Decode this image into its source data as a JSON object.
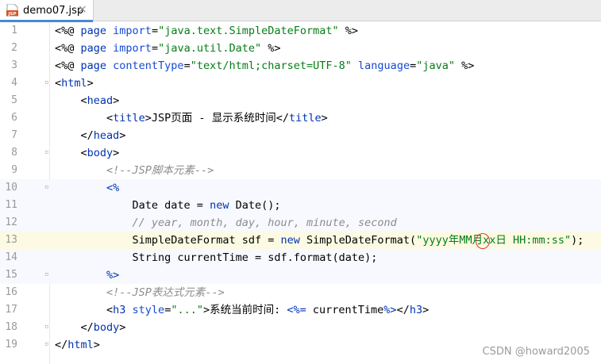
{
  "tab": {
    "icon": "jsp-file-icon",
    "icon_text": "JSP",
    "label": "demo07.jsp",
    "close": "×"
  },
  "editor": {
    "current_line": 13,
    "lines": [
      {
        "n": "1",
        "parts": [
          [
            "d",
            "<%@ "
          ],
          [
            "k",
            "page "
          ],
          [
            "a",
            "import"
          ],
          [
            "d",
            "="
          ],
          [
            "s",
            "\"java.text.SimpleDateFormat\""
          ],
          [
            "d",
            " %>"
          ]
        ]
      },
      {
        "n": "2",
        "parts": [
          [
            "d",
            "<%@ "
          ],
          [
            "k",
            "page "
          ],
          [
            "a",
            "import"
          ],
          [
            "d",
            "="
          ],
          [
            "s",
            "\"java.util.Date\""
          ],
          [
            "d",
            " %>"
          ]
        ]
      },
      {
        "n": "3",
        "parts": [
          [
            "d",
            "<%@ "
          ],
          [
            "k",
            "page "
          ],
          [
            "a",
            "contentType"
          ],
          [
            "d",
            "="
          ],
          [
            "s",
            "\"text/html;charset=UTF-8\""
          ],
          [
            "d",
            " "
          ],
          [
            "a",
            "language"
          ],
          [
            "d",
            "="
          ],
          [
            "s",
            "\"java\""
          ],
          [
            "d",
            " %>"
          ]
        ]
      },
      {
        "n": "4",
        "parts": [
          [
            "d",
            "<"
          ],
          [
            "t",
            "html"
          ],
          [
            "d",
            ">"
          ]
        ]
      },
      {
        "n": "5",
        "parts": [
          [
            "d",
            "    <"
          ],
          [
            "t",
            "head"
          ],
          [
            "d",
            ">"
          ]
        ]
      },
      {
        "n": "6",
        "parts": [
          [
            "d",
            "        <"
          ],
          [
            "t",
            "title"
          ],
          [
            "d",
            ">JSP页面 - 显示系统时间</"
          ],
          [
            "t",
            "title"
          ],
          [
            "d",
            ">"
          ]
        ]
      },
      {
        "n": "7",
        "parts": [
          [
            "d",
            "    </"
          ],
          [
            "t",
            "head"
          ],
          [
            "d",
            ">"
          ]
        ]
      },
      {
        "n": "8",
        "parts": [
          [
            "d",
            "    <"
          ],
          [
            "t",
            "body"
          ],
          [
            "d",
            ">"
          ]
        ]
      },
      {
        "n": "9",
        "parts": [
          [
            "c",
            "        <!--JSP脚本元素-->"
          ]
        ]
      },
      {
        "n": "10",
        "parts": [
          [
            "d",
            "        "
          ],
          [
            "t",
            "<%"
          ]
        ]
      },
      {
        "n": "11",
        "parts": [
          [
            "d",
            "            Date date = "
          ],
          [
            "k",
            "new"
          ],
          [
            "d",
            " Date();"
          ]
        ]
      },
      {
        "n": "12",
        "parts": [
          [
            "c",
            "            // year, month, day, hour, minute, second"
          ]
        ]
      },
      {
        "n": "13",
        "parts": [
          [
            "d",
            "            SimpleDateFormat sdf = "
          ],
          [
            "k",
            "new"
          ],
          [
            "d",
            " SimpleDateFormat("
          ],
          [
            "s",
            "\"yyyy年MM月xx日 HH:mm:ss\""
          ],
          [
            "d",
            ");"
          ]
        ]
      },
      {
        "n": "14",
        "parts": [
          [
            "d",
            "            String currentTime = sdf.format(date);"
          ]
        ]
      },
      {
        "n": "15",
        "parts": [
          [
            "d",
            "        "
          ],
          [
            "t",
            "%>"
          ]
        ]
      },
      {
        "n": "16",
        "parts": [
          [
            "c",
            "        <!--JSP表达式元素-->"
          ]
        ]
      },
      {
        "n": "17",
        "parts": [
          [
            "d",
            "        <"
          ],
          [
            "t",
            "h3 "
          ],
          [
            "a",
            "style"
          ],
          [
            "d",
            "="
          ],
          [
            "s",
            "\"...\""
          ],
          [
            "d",
            ">系统当前时间: "
          ],
          [
            "t",
            "<%="
          ],
          [
            "d",
            " currentTime"
          ],
          [
            "t",
            "%>"
          ],
          [
            "d",
            "</"
          ],
          [
            "t",
            "h3"
          ],
          [
            "d",
            ">"
          ]
        ]
      },
      {
        "n": "18",
        "parts": [
          [
            "d",
            "    </"
          ],
          [
            "t",
            "body"
          ],
          [
            "d",
            ">"
          ]
        ]
      },
      {
        "n": "19",
        "parts": [
          [
            "d",
            "</"
          ],
          [
            "t",
            "html"
          ],
          [
            "d",
            ">"
          ]
        ]
      }
    ]
  },
  "watermark": "CSDN @howard2005"
}
